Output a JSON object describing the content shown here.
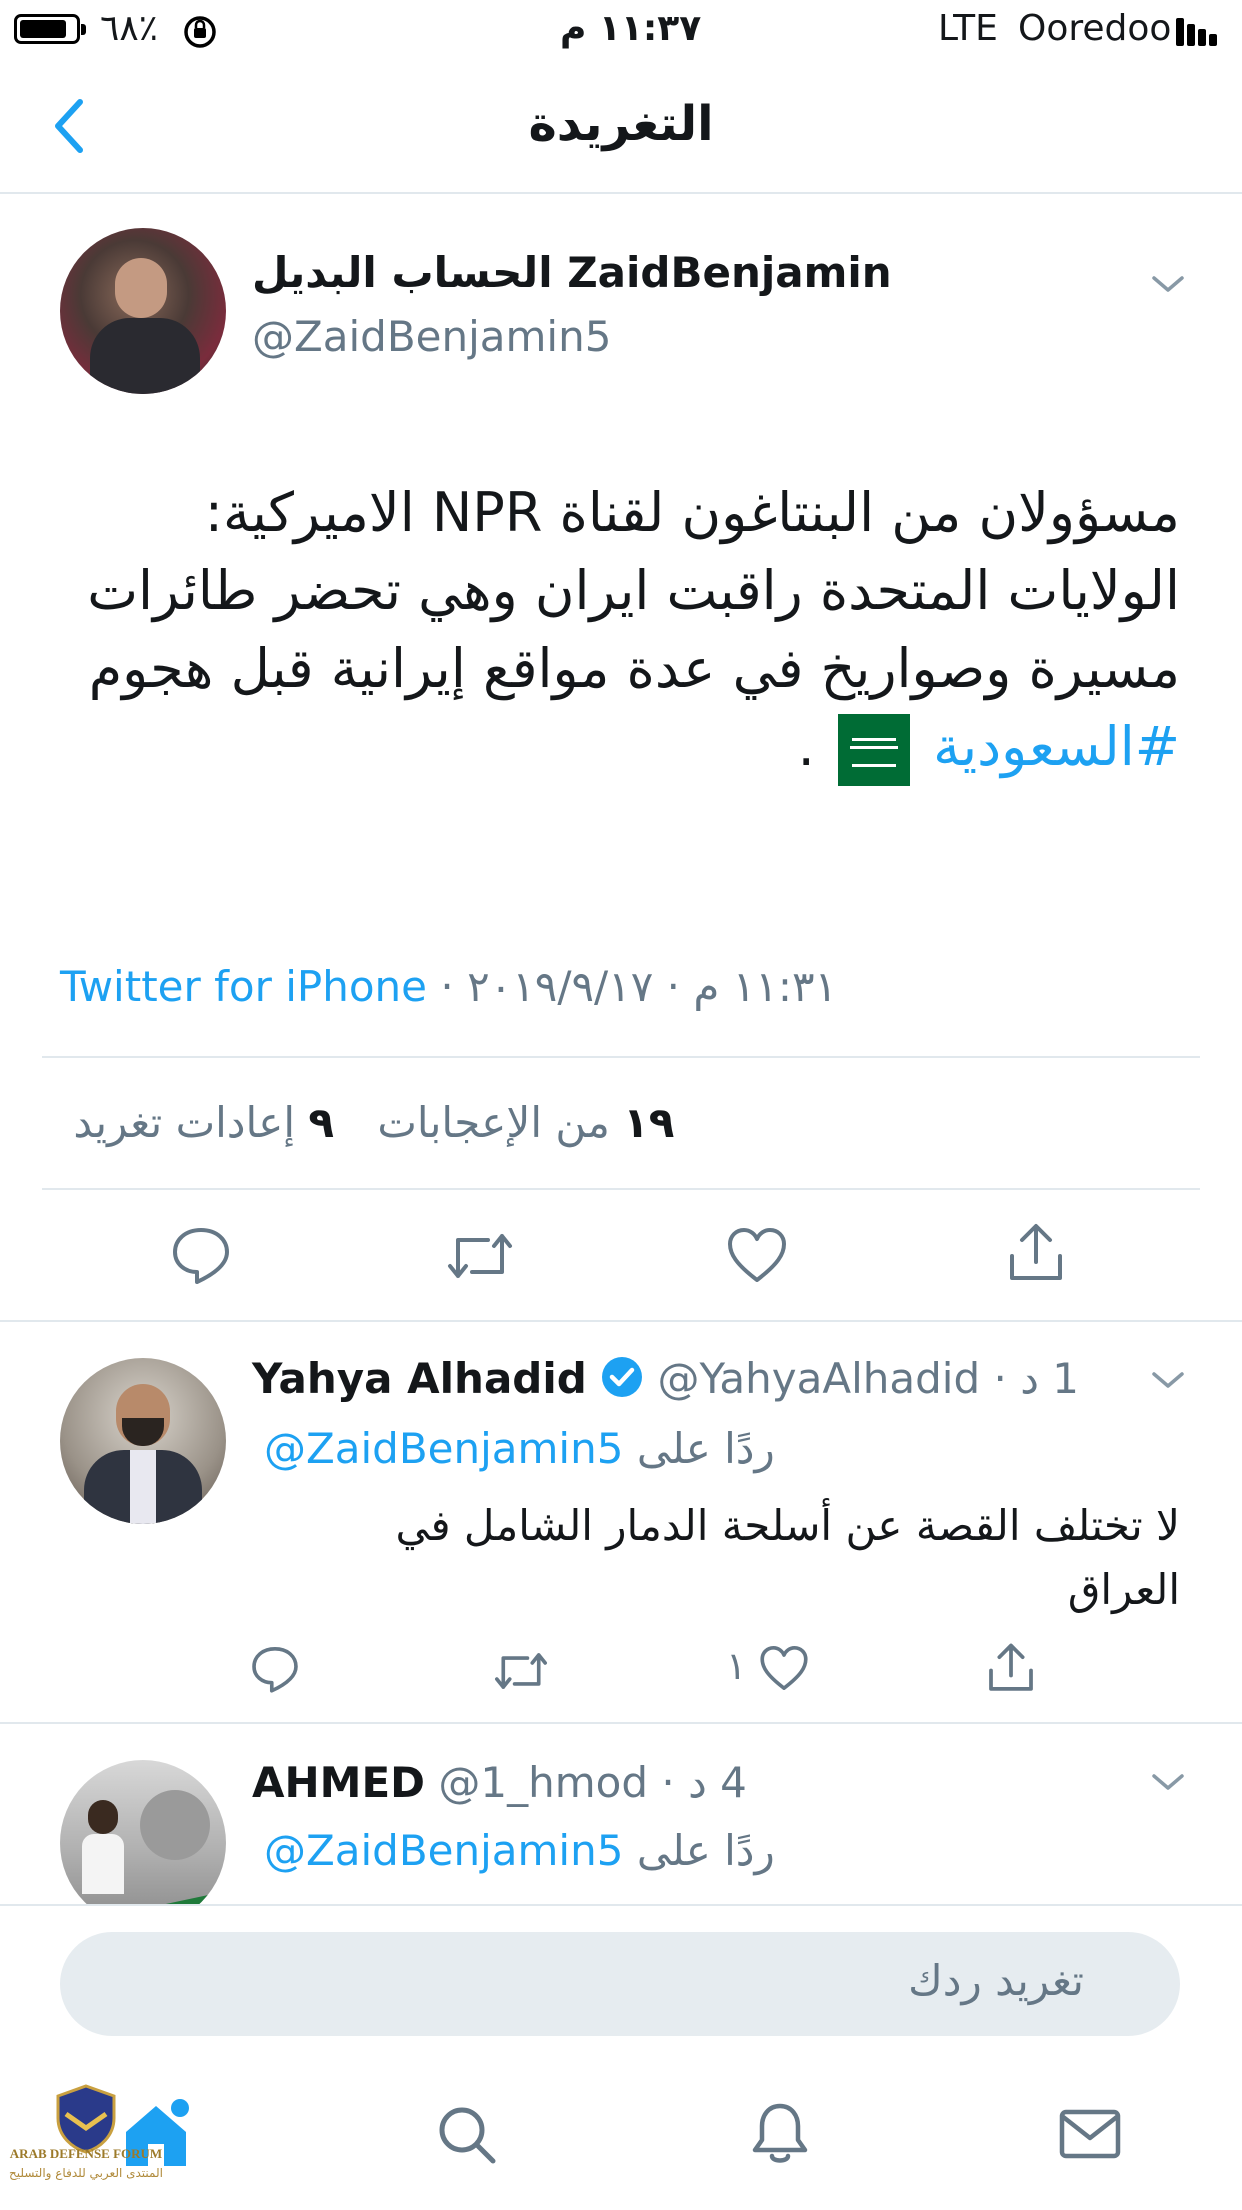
{
  "status_bar": {
    "carrier": "Ooredoo",
    "network": "LTE",
    "time": "١١:٣٧ م",
    "battery": "٦٨٪"
  },
  "header": {
    "title": "التغريدة"
  },
  "tweet": {
    "display_name": "الحساب البديل ZaidBenjamin",
    "handle": "@ZaidBenjamin5",
    "text_lines": [
      "مسؤولان من البنتاغون لقناة NPR الاميركية:",
      "الولايات المتحدة راقبت ايران وهي تحضر طائرات",
      "مسيرة وصواريخ في عدة مواقع إيرانية قبل هجوم"
    ],
    "hashtag": "#السعودية",
    "end_punct": ".",
    "time": "١١:٣١ م",
    "date": "٢٠١٩/٩/١٧",
    "sep": "·",
    "client": "Twitter for iPhone",
    "likes_count": "١٩",
    "likes_label": "من الإعجابات",
    "retweets_count": "٩",
    "retweets_label": "إعادات تغريد"
  },
  "replies": [
    {
      "name": "Yahya Alhadid",
      "handle": "@YahyaAlhadid",
      "time": "1 د",
      "replying_prefix": "ردًا على",
      "replying_handle": "@ZaidBenjamin5",
      "text_line1": "لا تختلف القصة عن أسلحة الدمار الشامل في",
      "text_line2": "العراق",
      "like_count": "١"
    },
    {
      "name": "AHMED",
      "handle": "@1_hmod",
      "time": "4 د",
      "replying_prefix": "ردًا على",
      "replying_handle": "@ZaidBenjamin5"
    }
  ],
  "reply_box": {
    "placeholder": "تغريد ردك"
  },
  "watermark": {
    "line1": "ARAB DEFENSE FORUM",
    "line2": "المنتدى العربي للدفاع والتسليح"
  },
  "colors": {
    "accent": "#1da1f2",
    "icon_grey": "#657786",
    "divider": "#e1e8ed"
  }
}
